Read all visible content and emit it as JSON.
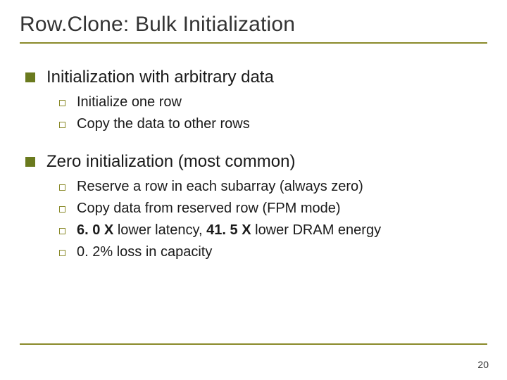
{
  "title": "Row.Clone: Bulk Initialization",
  "sections": [
    {
      "heading": "Initialization with arbitrary data",
      "items": [
        {
          "text": "Initialize one row"
        },
        {
          "text": "Copy the data to other rows"
        }
      ]
    },
    {
      "heading": "Zero initialization (most common)",
      "items": [
        {
          "text": "Reserve a row in each subarray (always zero)"
        },
        {
          "text": "Copy data from reserved row (FPM mode)"
        },
        {
          "bold_prefix": "6. 0 X",
          "mid": " lower latency, ",
          "bold_mid": "41. 5 X",
          "suffix": " lower DRAM energy"
        },
        {
          "text": "0. 2% loss in capacity"
        }
      ]
    }
  ],
  "page_number": "20"
}
